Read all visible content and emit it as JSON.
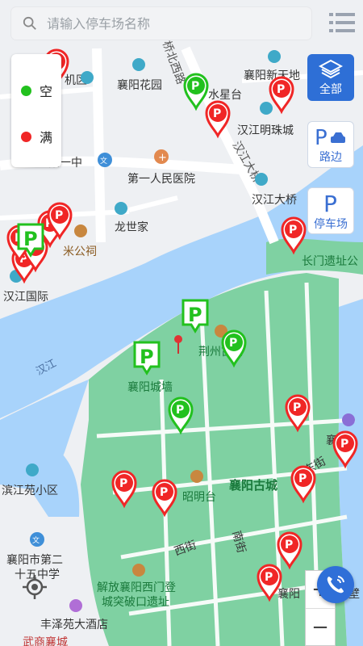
{
  "search": {
    "placeholder": "请输入停车场名称"
  },
  "legend": {
    "items": [
      {
        "label": "空",
        "color": "#22c11e"
      },
      {
        "label": "满",
        "color": "#f02626"
      }
    ]
  },
  "side_buttons": [
    {
      "label": "全部",
      "icon": "layers-icon",
      "active": true
    },
    {
      "label": "路边",
      "icon": "parking-car-icon",
      "active": false
    },
    {
      "label": "停车场",
      "icon": "parking-icon",
      "active": false
    }
  ],
  "zoom": {
    "in_label": "+",
    "out_label": "−"
  },
  "map": {
    "labels": {
      "ji_qu": "机区",
      "xiangyang_huayuan": "襄阳花园",
      "qiao_bei_xi_lu": "桥北西路",
      "xiangyang_xintiandi": "襄阳新天地",
      "shuixingtai": "水星台",
      "hanjiang_mingzhucheng": "汉江明珠城",
      "yizhong": "阳一中",
      "diyi_renmin_yiyuan": "第一人民医院",
      "hanjiang_daqiao_road": "汉江大桥",
      "hanjiang_daqiao": "汉江大桥",
      "longshijia": "龙世家",
      "mi_gong_ci": "米公祠",
      "changmen_yizhi": "长门遗址公",
      "hanjiang_guoji": "汉江国际",
      "hanjiang_river": "汉江",
      "jingzhou_gujie": "荆州古街",
      "xiangyang_chengqiang": "襄阳城墙",
      "binjiang_yuan": "滨江苑小区",
      "zhaomingtai": "昭明台",
      "xiangyang_gucheng": "襄阳古城",
      "dongjie": "东街",
      "xiang_right": "襄",
      "xijie": "西街",
      "nanjie": "南街",
      "school25_line1": "襄阳市第二",
      "school25_line2": "十五中学",
      "jiefang_line1": "解放襄阳西门登",
      "jiefang_line2": "城突破口遗址",
      "xiangyang_right2": "襄阳",
      "bi": "壁",
      "fengze": "丰泽苑大酒店",
      "wunan": "武商襄城"
    },
    "markers": [
      {
        "type": "round",
        "status": "full"
      },
      {
        "type": "round",
        "status": "empty"
      },
      {
        "type": "round",
        "status": "full"
      },
      {
        "type": "round",
        "status": "full"
      },
      {
        "type": "round",
        "status": "full"
      },
      {
        "type": "round",
        "status": "full"
      },
      {
        "type": "round",
        "status": "full"
      },
      {
        "type": "round",
        "status": "full"
      },
      {
        "type": "round",
        "status": "full"
      },
      {
        "type": "round",
        "status": "full"
      },
      {
        "type": "round",
        "status": "empty"
      },
      {
        "type": "round",
        "status": "empty"
      },
      {
        "type": "round",
        "status": "full"
      },
      {
        "type": "round",
        "status": "full"
      },
      {
        "type": "round",
        "status": "full"
      },
      {
        "type": "round",
        "status": "full"
      },
      {
        "type": "round",
        "status": "full"
      },
      {
        "type": "round",
        "status": "full"
      },
      {
        "type": "round",
        "status": "full"
      },
      {
        "type": "round",
        "status": "full"
      },
      {
        "type": "square",
        "status": "empty"
      },
      {
        "type": "square",
        "status": "empty"
      },
      {
        "type": "square",
        "status": "empty"
      }
    ]
  }
}
